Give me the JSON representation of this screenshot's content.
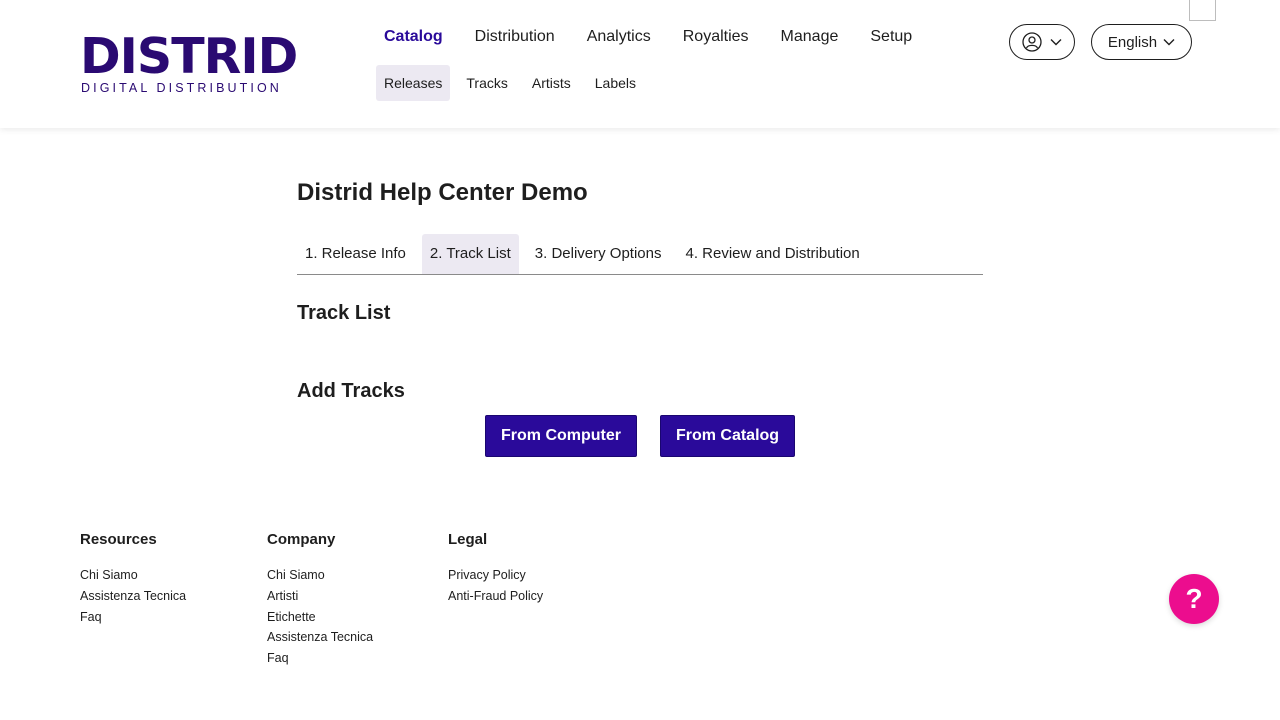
{
  "logo": {
    "main": "DISTRID",
    "sub": "DIGITAL DISTRIBUTION"
  },
  "main_nav": [
    "Catalog",
    "Distribution",
    "Analytics",
    "Royalties",
    "Manage",
    "Setup"
  ],
  "sub_nav": [
    "Releases",
    "Tracks",
    "Artists",
    "Labels"
  ],
  "account": {
    "user_icon": "user-circle-icon",
    "language": "English"
  },
  "page": {
    "title": "Distrid Help Center Demo",
    "tabs": [
      "1. Release Info",
      "2. Track List",
      "3. Delivery Options",
      "4. Review and Distribution"
    ],
    "active_tab": "2. Track List",
    "track_list_title": "Track List",
    "add_tracks_title": "Add Tracks",
    "from_computer": "From Computer",
    "from_catalog": "From Catalog"
  },
  "footer": {
    "resources": {
      "title": "Resources",
      "links": [
        "Chi Siamo",
        "Assistenza Tecnica",
        "Faq"
      ]
    },
    "company": {
      "title": "Company",
      "links": [
        "Chi Siamo",
        "Artisti",
        "Etichette",
        "Assistenza Tecnica",
        "Faq"
      ]
    },
    "legal": {
      "title": "Legal",
      "links": [
        "Privacy Policy",
        "Anti-Fraud Policy"
      ]
    }
  },
  "help": {
    "label": "?"
  },
  "colors": {
    "brand": "#2a0a72",
    "primary": "#2a0a9a",
    "help": "#ec0d8e",
    "active_bg": "#ece9f2"
  }
}
